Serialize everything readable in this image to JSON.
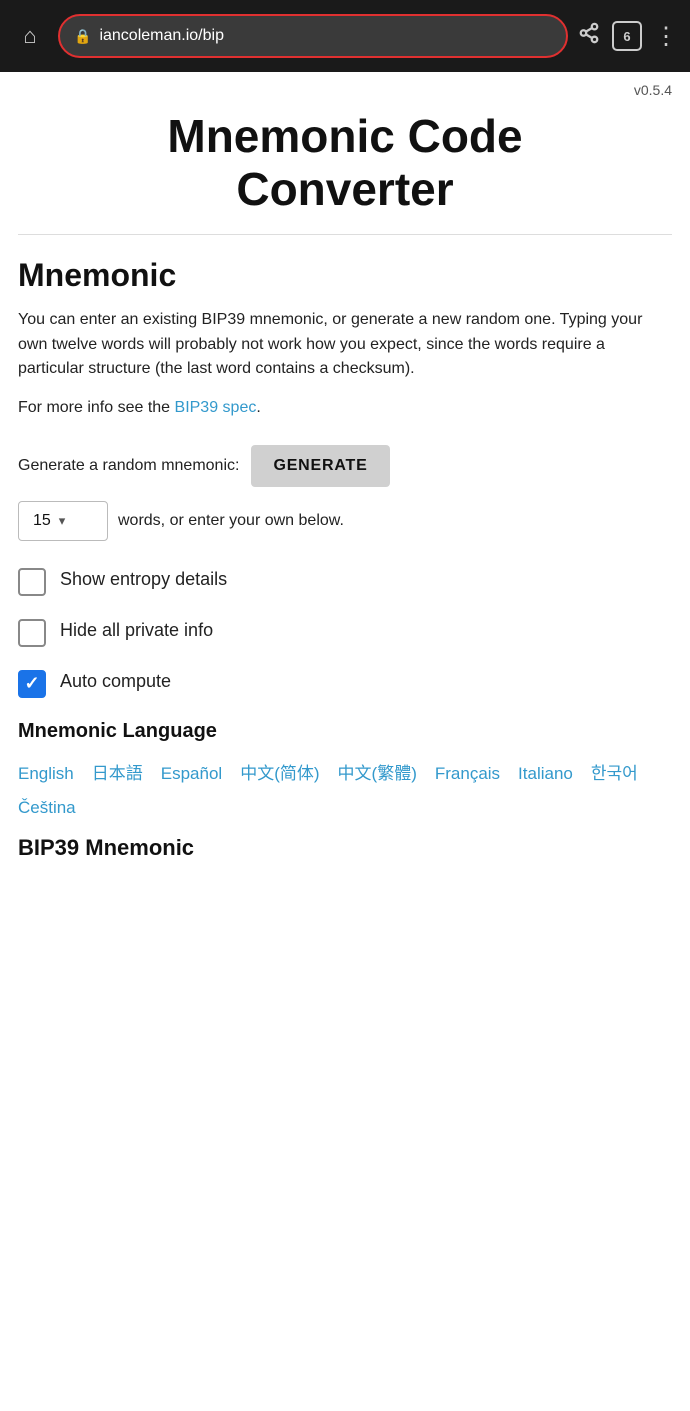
{
  "browser": {
    "url": "iancoleman.io/bip",
    "home_icon": "⌂",
    "lock_icon": "🔒",
    "share_icon": "share",
    "tab_count": "6",
    "dots_icon": "⋮"
  },
  "app": {
    "version": "v0.5.4",
    "title_line1": "Mnemonic Code",
    "title_line2": "Converter"
  },
  "mnemonic": {
    "section_title": "Mnemonic",
    "description": "You can enter an existing BIP39 mnemonic, or generate a new random one. Typing your own twelve words will probably not work how you expect, since the words require a particular structure (the last word contains a checksum).",
    "bip39_link_text": "BIP39 spec",
    "for_more_info_prefix": "For more info see the ",
    "for_more_info_suffix": ".",
    "generate_label": "Generate a random mnemonic:",
    "generate_button": "GENERATE",
    "words_count": "15",
    "words_suffix": "words, or enter your own below.",
    "show_entropy_label": "Show entropy details",
    "hide_private_label": "Hide all private info",
    "auto_compute_label": "Auto compute",
    "show_entropy_checked": false,
    "hide_private_checked": false,
    "auto_compute_checked": true
  },
  "language": {
    "section_title": "Mnemonic Language",
    "languages": [
      "English",
      "日本語",
      "Español",
      "中文(简体)",
      "中文(繁體)",
      "Français",
      "Italiano",
      "한국어",
      "Čeština"
    ],
    "bottom_partial": "BIP39 Mnemonic"
  }
}
